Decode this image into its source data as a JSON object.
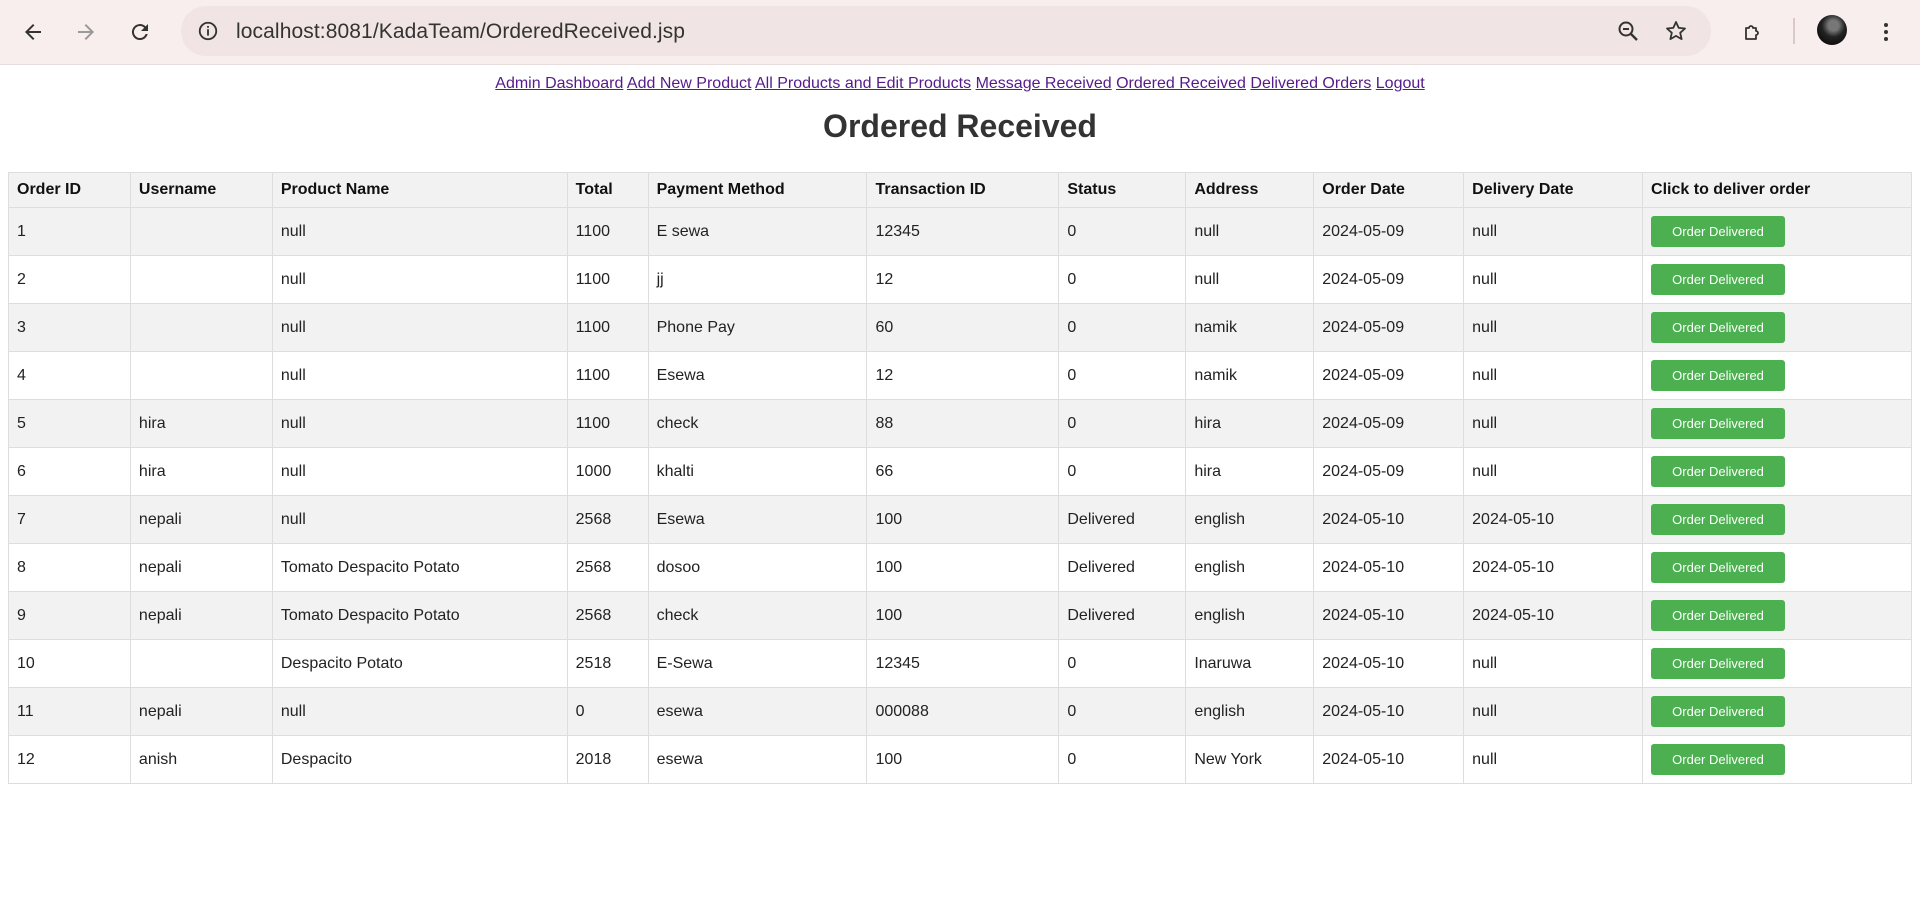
{
  "browser": {
    "url": "localhost:8081/KadaTeam/OrderedReceived.jsp",
    "icons": [
      "back-icon",
      "forward-icon",
      "reload-icon",
      "site-info-icon",
      "zoom-icon",
      "bookmark-star-icon",
      "extensions-icon",
      "profile-avatar",
      "menu-icon"
    ]
  },
  "nav_links": [
    "Admin Dashboard",
    "Add New Product",
    "All Products and Edit Products",
    "Message Received",
    "Ordered Received",
    "Delivered Orders",
    "Logout"
  ],
  "page_title": "Ordered Received",
  "table": {
    "headers": [
      "Order ID",
      "Username",
      "Product Name",
      "Total",
      "Payment Method",
      "Transaction ID",
      "Status",
      "Address",
      "Order Date",
      "Delivery Date",
      "Click to deliver order"
    ],
    "action_label": "Order Delivered",
    "rows": [
      [
        "1",
        "",
        "null",
        "1100",
        "E sewa",
        "12345",
        "0",
        "null",
        "2024-05-09",
        "null"
      ],
      [
        "2",
        "",
        "null",
        "1100",
        "jj",
        "12",
        "0",
        "null",
        "2024-05-09",
        "null"
      ],
      [
        "3",
        "",
        "null",
        "1100",
        "Phone Pay",
        "60",
        "0",
        "namik",
        "2024-05-09",
        "null"
      ],
      [
        "4",
        "",
        "null",
        "1100",
        "Esewa",
        "12",
        "0",
        "namik",
        "2024-05-09",
        "null"
      ],
      [
        "5",
        "hira",
        "null",
        "1100",
        "check",
        "88",
        "0",
        "hira",
        "2024-05-09",
        "null"
      ],
      [
        "6",
        "hira",
        "null",
        "1000",
        "khalti",
        "66",
        "0",
        "hira",
        "2024-05-09",
        "null"
      ],
      [
        "7",
        "nepali",
        "null",
        "2568",
        "Esewa",
        "100",
        "Delivered",
        "english",
        "2024-05-10",
        "2024-05-10"
      ],
      [
        "8",
        "nepali",
        "Tomato Despacito Potato",
        "2568",
        "dosoo",
        "100",
        "Delivered",
        "english",
        "2024-05-10",
        "2024-05-10"
      ],
      [
        "9",
        "nepali",
        "Tomato Despacito Potato",
        "2568",
        "check",
        "100",
        "Delivered",
        "english",
        "2024-05-10",
        "2024-05-10"
      ],
      [
        "10",
        "",
        "Despacito Potato",
        "2518",
        "E-Sewa",
        "12345",
        "0",
        "Inaruwa",
        "2024-05-10",
        "null"
      ],
      [
        "11",
        "nepali",
        "null",
        "0",
        "esewa",
        "000088",
        "0",
        "english",
        "2024-05-10",
        "null"
      ],
      [
        "12",
        "anish",
        "Despacito",
        "2018",
        "esewa",
        "100",
        "0",
        "New York",
        "2024-05-10",
        "null"
      ]
    ]
  },
  "colors": {
    "button_green": "#4caf50",
    "link_visited": "#551a8b",
    "chrome_bg": "#f9eeee"
  }
}
